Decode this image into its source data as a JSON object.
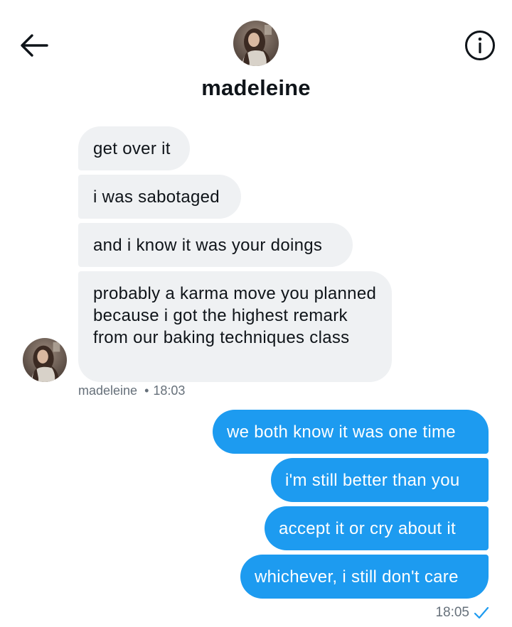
{
  "header": {
    "contact_name": "madeleine",
    "back_icon": "arrow-left-icon",
    "info_icon": "info-icon"
  },
  "received": {
    "messages": [
      "get over it",
      "i was sabotaged",
      "and i know it was your doings",
      "probably a karma move you planned because i got the highest remark from our baking techniques class"
    ],
    "sender": "madeleine",
    "separator": "•",
    "time": "18:03",
    "bubble_color": "#eff1f3"
  },
  "sent": {
    "messages": [
      "we both know it was one time",
      "i'm still better than you",
      "accept it or cry about it",
      "whichever, i still don't care"
    ],
    "time": "18:05",
    "status_icon": "checkmark-icon",
    "bubble_color": "#1d9bf0"
  }
}
